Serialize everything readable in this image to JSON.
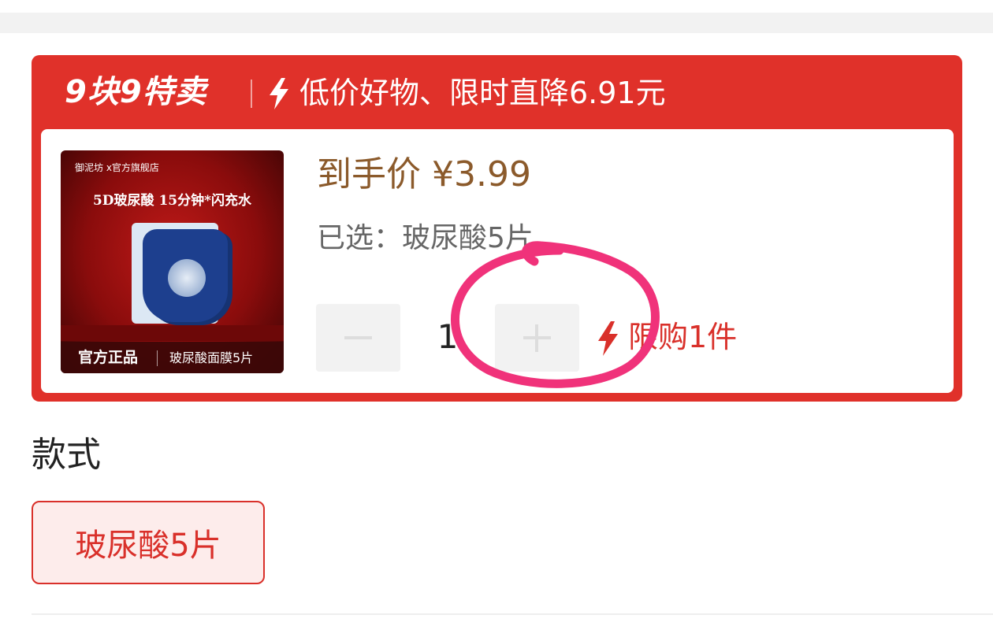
{
  "promo": {
    "badge": "9块9特卖",
    "tagline": "低价好物、限时直降6.91元",
    "header_icon": "lightning-bolt-icon",
    "color": "#e0312a"
  },
  "product": {
    "image": {
      "brand_line": "御泥坊 x官方旗舰店",
      "headline": "5D玻尿酸 15分钟*闪充水",
      "footer_left": "官方正品",
      "footer_right": "玻尿酸面膜5片"
    },
    "price": {
      "label": "到手价",
      "value": "¥3.99",
      "color": "#8b5a2b"
    },
    "selected": "已选：玻尿酸5片",
    "quantity": {
      "minus_icon": "minus-icon",
      "plus_icon": "plus-icon",
      "value": "1"
    },
    "limit": {
      "icon": "lightning-bolt-icon",
      "text": "限购1件",
      "color": "#d9302a"
    }
  },
  "annotation": {
    "shape": "hand-drawn-circle",
    "color": "#f0327a"
  },
  "style_section": {
    "title": "款式",
    "options": [
      {
        "label": "玻尿酸5片",
        "selected": true
      }
    ]
  }
}
